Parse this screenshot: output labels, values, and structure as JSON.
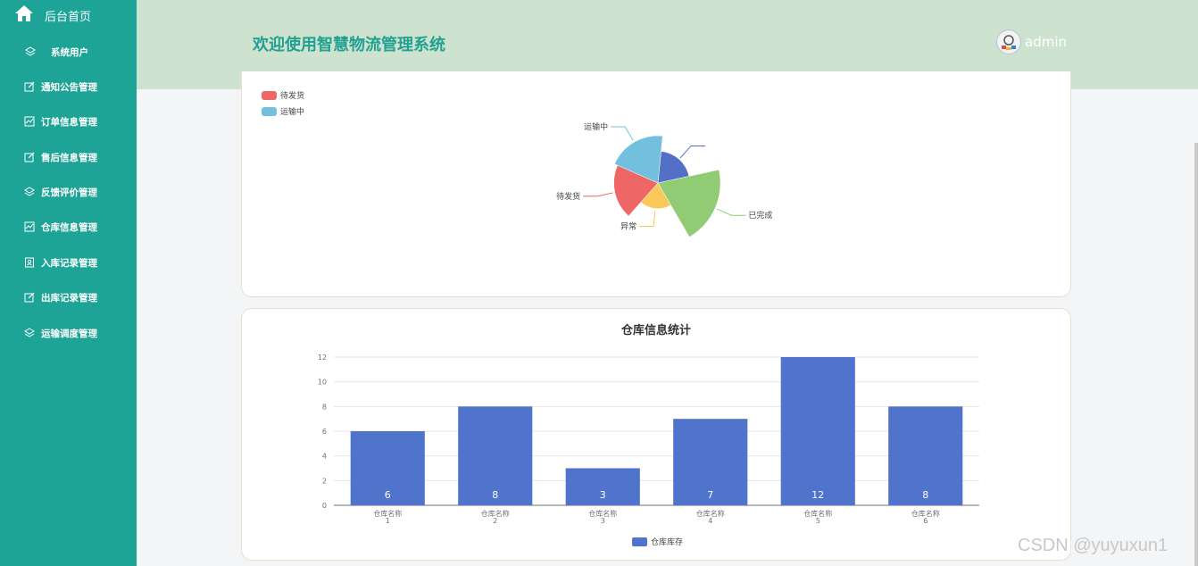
{
  "sidebar": {
    "home_label": "后台首页",
    "items": [
      {
        "label": "系统用户",
        "icon": "layers-icon"
      },
      {
        "label": "通知公告管理",
        "icon": "edit-icon"
      },
      {
        "label": "订单信息管理",
        "icon": "chart-icon"
      },
      {
        "label": "售后信息管理",
        "icon": "edit-icon"
      },
      {
        "label": "反馈评价管理",
        "icon": "layers-icon"
      },
      {
        "label": "仓库信息管理",
        "icon": "chart-icon"
      },
      {
        "label": "入库记录管理",
        "icon": "id-card-icon"
      },
      {
        "label": "出库记录管理",
        "icon": "edit-icon"
      },
      {
        "label": "运输调度管理",
        "icon": "layers-icon"
      }
    ]
  },
  "header": {
    "title": "欢迎使用智慧物流管理系统",
    "username": "admin"
  },
  "watermark": "CSDN @yuyuxun1",
  "colors": {
    "sidebar": "#1ea497",
    "header": "#cde3d0",
    "bar": "#5073cc"
  },
  "chart_data": [
    {
      "type": "pie",
      "rose": true,
      "legend": [
        "待发货",
        "运输中"
      ],
      "slices": [
        {
          "name": "",
          "value": 1,
          "color": "#5470c6"
        },
        {
          "name": "已完成",
          "value": 6,
          "color": "#91cc75"
        },
        {
          "name": "异常",
          "value": 0.5,
          "color": "#fac858"
        },
        {
          "name": "待发货",
          "value": 2.5,
          "color": "#ee6666"
        },
        {
          "name": "运输中",
          "value": 3,
          "color": "#73c0de"
        }
      ]
    },
    {
      "type": "bar",
      "title": "仓库信息统计",
      "categories": [
        "仓库名称\n1",
        "仓库名称\n2",
        "仓库名称\n3",
        "仓库名称\n4",
        "仓库名称\n5",
        "仓库名称\n6"
      ],
      "series": [
        {
          "name": "仓库库存",
          "values": [
            6,
            8,
            3,
            7,
            12,
            8
          ]
        }
      ],
      "ylim": [
        0,
        12
      ],
      "yticks": [
        0,
        2,
        4,
        6,
        8,
        10,
        12
      ],
      "legend": "bottom-center",
      "grid": true
    }
  ]
}
